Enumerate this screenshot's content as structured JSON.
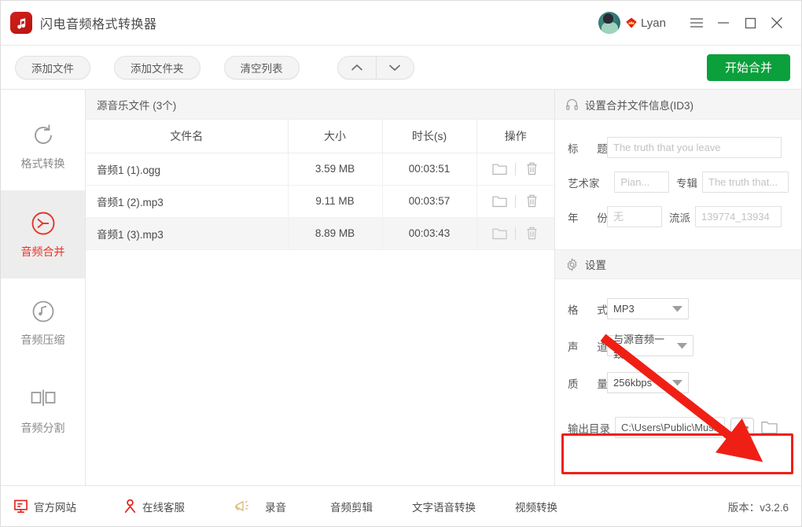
{
  "titlebar": {
    "app_name": "闪电音频格式转换器",
    "logo_icon": "music-note-icon",
    "username": "Lyan",
    "vip_badge_icon": "vip-crown-icon",
    "menu_icon": "hamburger-menu-icon",
    "minimize_icon": "minimize-icon",
    "maximize_icon": "maximize-icon",
    "close_icon": "close-icon"
  },
  "toolbar": {
    "add_file": "添加文件",
    "add_folder": "添加文件夹",
    "clear_list": "清空列表",
    "move_up_icon": "chevron-up-icon",
    "move_down_icon": "chevron-down-icon",
    "start": "开始合并"
  },
  "sidebar": {
    "items": [
      {
        "label": "格式转换",
        "icon": "refresh-circle-icon",
        "active": false
      },
      {
        "label": "音频合并",
        "icon": "merge-arrow-circle-icon",
        "active": true
      },
      {
        "label": "音频压缩",
        "icon": "music-note-circle-icon",
        "active": false
      },
      {
        "label": "音频分割",
        "icon": "split-squares-icon",
        "active": false
      }
    ]
  },
  "filelist": {
    "header": "源音乐文件 (3个)",
    "columns": [
      "文件名",
      "大小",
      "时长(s)",
      "操作"
    ],
    "rows": [
      {
        "name": "音频1 (1).ogg",
        "size": "3.59 MB",
        "duration": "00:03:51"
      },
      {
        "name": "音频1 (2).mp3",
        "size": "9.11 MB",
        "duration": "00:03:57"
      },
      {
        "name": "音频1 (3).mp3",
        "size": "8.89 MB",
        "duration": "00:03:43"
      }
    ],
    "row_actions": {
      "open_folder_icon": "folder-icon",
      "delete_icon": "trash-icon"
    }
  },
  "id3": {
    "section_title": "设置合并文件信息(ID3)",
    "section_icon": "headphones-icon",
    "title_label": "标 题",
    "title_placeholder": "The truth that you leave",
    "artist_label": "艺术家",
    "artist_placeholder": "Pian...",
    "album_label": "专辑",
    "album_placeholder": "The truth that...",
    "year_label": "年 份",
    "year_placeholder": "无",
    "genre_label": "流派",
    "genre_placeholder": "139774_13934"
  },
  "settings": {
    "section_title": "设置",
    "section_icon": "gear-icon",
    "format_label": "格 式",
    "format_value": "MP3",
    "channel_label": "声 道",
    "channel_value": "与源音频一致",
    "quality_label": "质 量",
    "quality_value": "256kbps",
    "output_label": "输出目录",
    "output_value": "C:\\Users\\Public\\Music\\",
    "browse_icon": "ellipsis-icon",
    "open_folder_icon": "folder-icon"
  },
  "bottombar": {
    "website": "官方网站",
    "website_icon": "monitor-icon",
    "support": "在线客服",
    "support_icon": "person-icon",
    "megaphone_icon": "megaphone-icon",
    "links": [
      "录音",
      "音频剪辑",
      "文字语音转换",
      "视频转换"
    ],
    "version": "版本：v3.2.6"
  },
  "colors": {
    "accent_red": "#e8352a",
    "accent_green": "#0ba03c",
    "annotation_red": "#f01f15",
    "logo_red": "#c4171170"
  }
}
